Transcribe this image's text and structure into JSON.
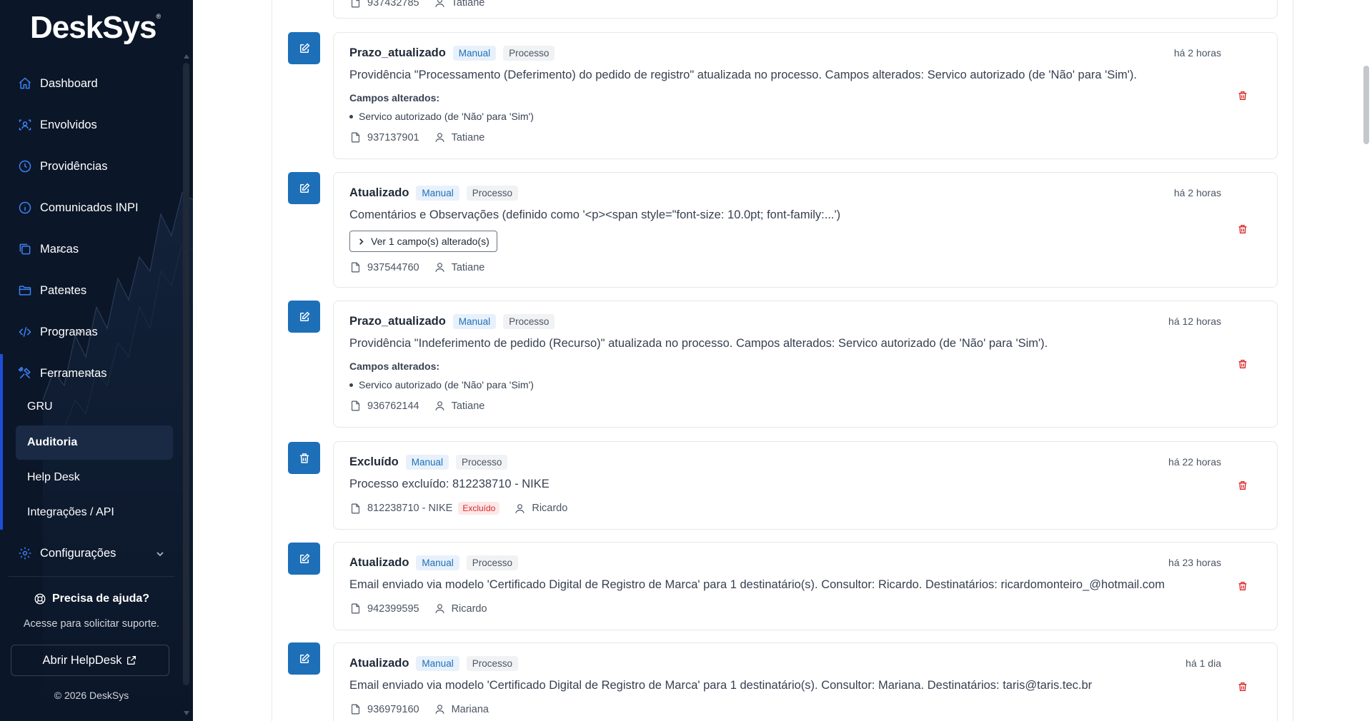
{
  "app": {
    "logo": "DeskSys",
    "logo_mark": "®"
  },
  "sidebar": {
    "items": [
      {
        "label": "Dashboard",
        "icon": "home-icon"
      },
      {
        "label": "Envolvidos",
        "icon": "users-scan-icon"
      },
      {
        "label": "Providências",
        "icon": "clock-icon"
      },
      {
        "label": "Comunicados INPI",
        "icon": "info-icon"
      },
      {
        "label": "Marcas",
        "icon": "copy-icon"
      },
      {
        "label": "Patentes",
        "icon": "folder-icon"
      },
      {
        "label": "Programas",
        "icon": "code-icon"
      },
      {
        "label": "Ferramentas",
        "icon": "tools-icon"
      },
      {
        "label": "Configurações",
        "icon": "gear-icon"
      }
    ],
    "subitems": [
      "GRU",
      "Auditoria",
      "Help Desk",
      "Integrações / API"
    ],
    "active_subitem": "Auditoria",
    "help": {
      "title": "Precisa de ajuda?",
      "subtitle": "Acesse para solicitar suporte.",
      "button": "Abrir HelpDesk"
    },
    "copyright": "© 2026 DeskSys"
  },
  "colors": {
    "sidebar_bg": "#0b1628",
    "accent": "#1d6fb8",
    "danger": "#dc2626"
  },
  "audit": {
    "top_partial": {
      "doc": "937432785",
      "user": "Tatiane"
    },
    "entries": [
      {
        "title": "Prazo_atualizado",
        "origin": "Manual",
        "entity": "Processo",
        "time": "há 2 horas",
        "description": "Providência \"Processamento (Deferimento) do pedido de registro\" atualizada no processo. Campos alterados: Servico autorizado (de 'Não' para 'Sim').",
        "fields_label": "Campos alterados:",
        "field": "Servico autorizado (de 'Não' para 'Sim')",
        "doc": "937137901",
        "user": "Tatiane"
      },
      {
        "title": "Atualizado",
        "origin": "Manual",
        "entity": "Processo",
        "time": "há 2 horas",
        "description": "Comentários e Observações (definido como '<p><span style=\"font-size: 10.0pt; font-family:...')",
        "expand_label": "Ver 1 campo(s) alterado(s)",
        "doc": "937544760",
        "user": "Tatiane"
      },
      {
        "title": "Prazo_atualizado",
        "origin": "Manual",
        "entity": "Processo",
        "time": "há 12 horas",
        "description": "Providência \"Indeferimento de pedido (Recurso)\" atualizada no processo. Campos alterados: Servico autorizado (de 'Não' para 'Sim').",
        "fields_label": "Campos alterados:",
        "field": "Servico autorizado (de 'Não' para 'Sim')",
        "doc": "936762144",
        "user": "Tatiane"
      },
      {
        "title": "Excluído",
        "origin": "Manual",
        "entity": "Processo",
        "time": "há 22 horas",
        "description": "Processo excluído: 812238710 - NIKE",
        "doc": "812238710 - NIKE",
        "doc_badge": "Excluído",
        "user": "Ricardo"
      },
      {
        "title": "Atualizado",
        "origin": "Manual",
        "entity": "Processo",
        "time": "há 23 horas",
        "description": "Email enviado via modelo 'Certificado Digital de Registro de Marca' para 1 destinatário(s). Consultor: Ricardo. Destinatários: ricardomonteiro_@hotmail.com",
        "doc": "942399595",
        "user": "Ricardo"
      },
      {
        "title": "Atualizado",
        "origin": "Manual",
        "entity": "Processo",
        "time": "há 1 dia",
        "description": "Email enviado via modelo 'Certificado Digital de Registro de Marca' para 1 destinatário(s). Consultor: Mariana. Destinatários: taris@taris.tec.br",
        "doc": "936979160",
        "user": "Mariana"
      }
    ]
  }
}
